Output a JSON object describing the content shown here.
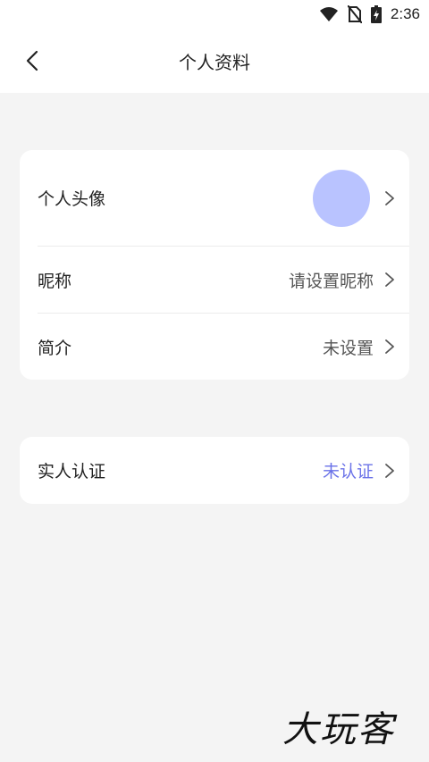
{
  "status_bar": {
    "time": "2:36"
  },
  "header": {
    "title": "个人资料"
  },
  "profile_card": {
    "avatar_label": "个人头像",
    "nickname_label": "昵称",
    "nickname_value": "请设置昵称",
    "bio_label": "简介",
    "bio_value": "未设置"
  },
  "verification_card": {
    "label": "实人认证",
    "value": "未认证"
  },
  "watermark": {
    "text": "大玩客"
  },
  "colors": {
    "accent": "#6a72e8",
    "avatar_placeholder": "#b9c3ff",
    "background": "#f4f4f4",
    "card": "#ffffff"
  },
  "icons": [
    "wifi-icon",
    "no-sim-icon",
    "battery-charging-icon",
    "back-icon",
    "chevron-right-icon"
  ]
}
